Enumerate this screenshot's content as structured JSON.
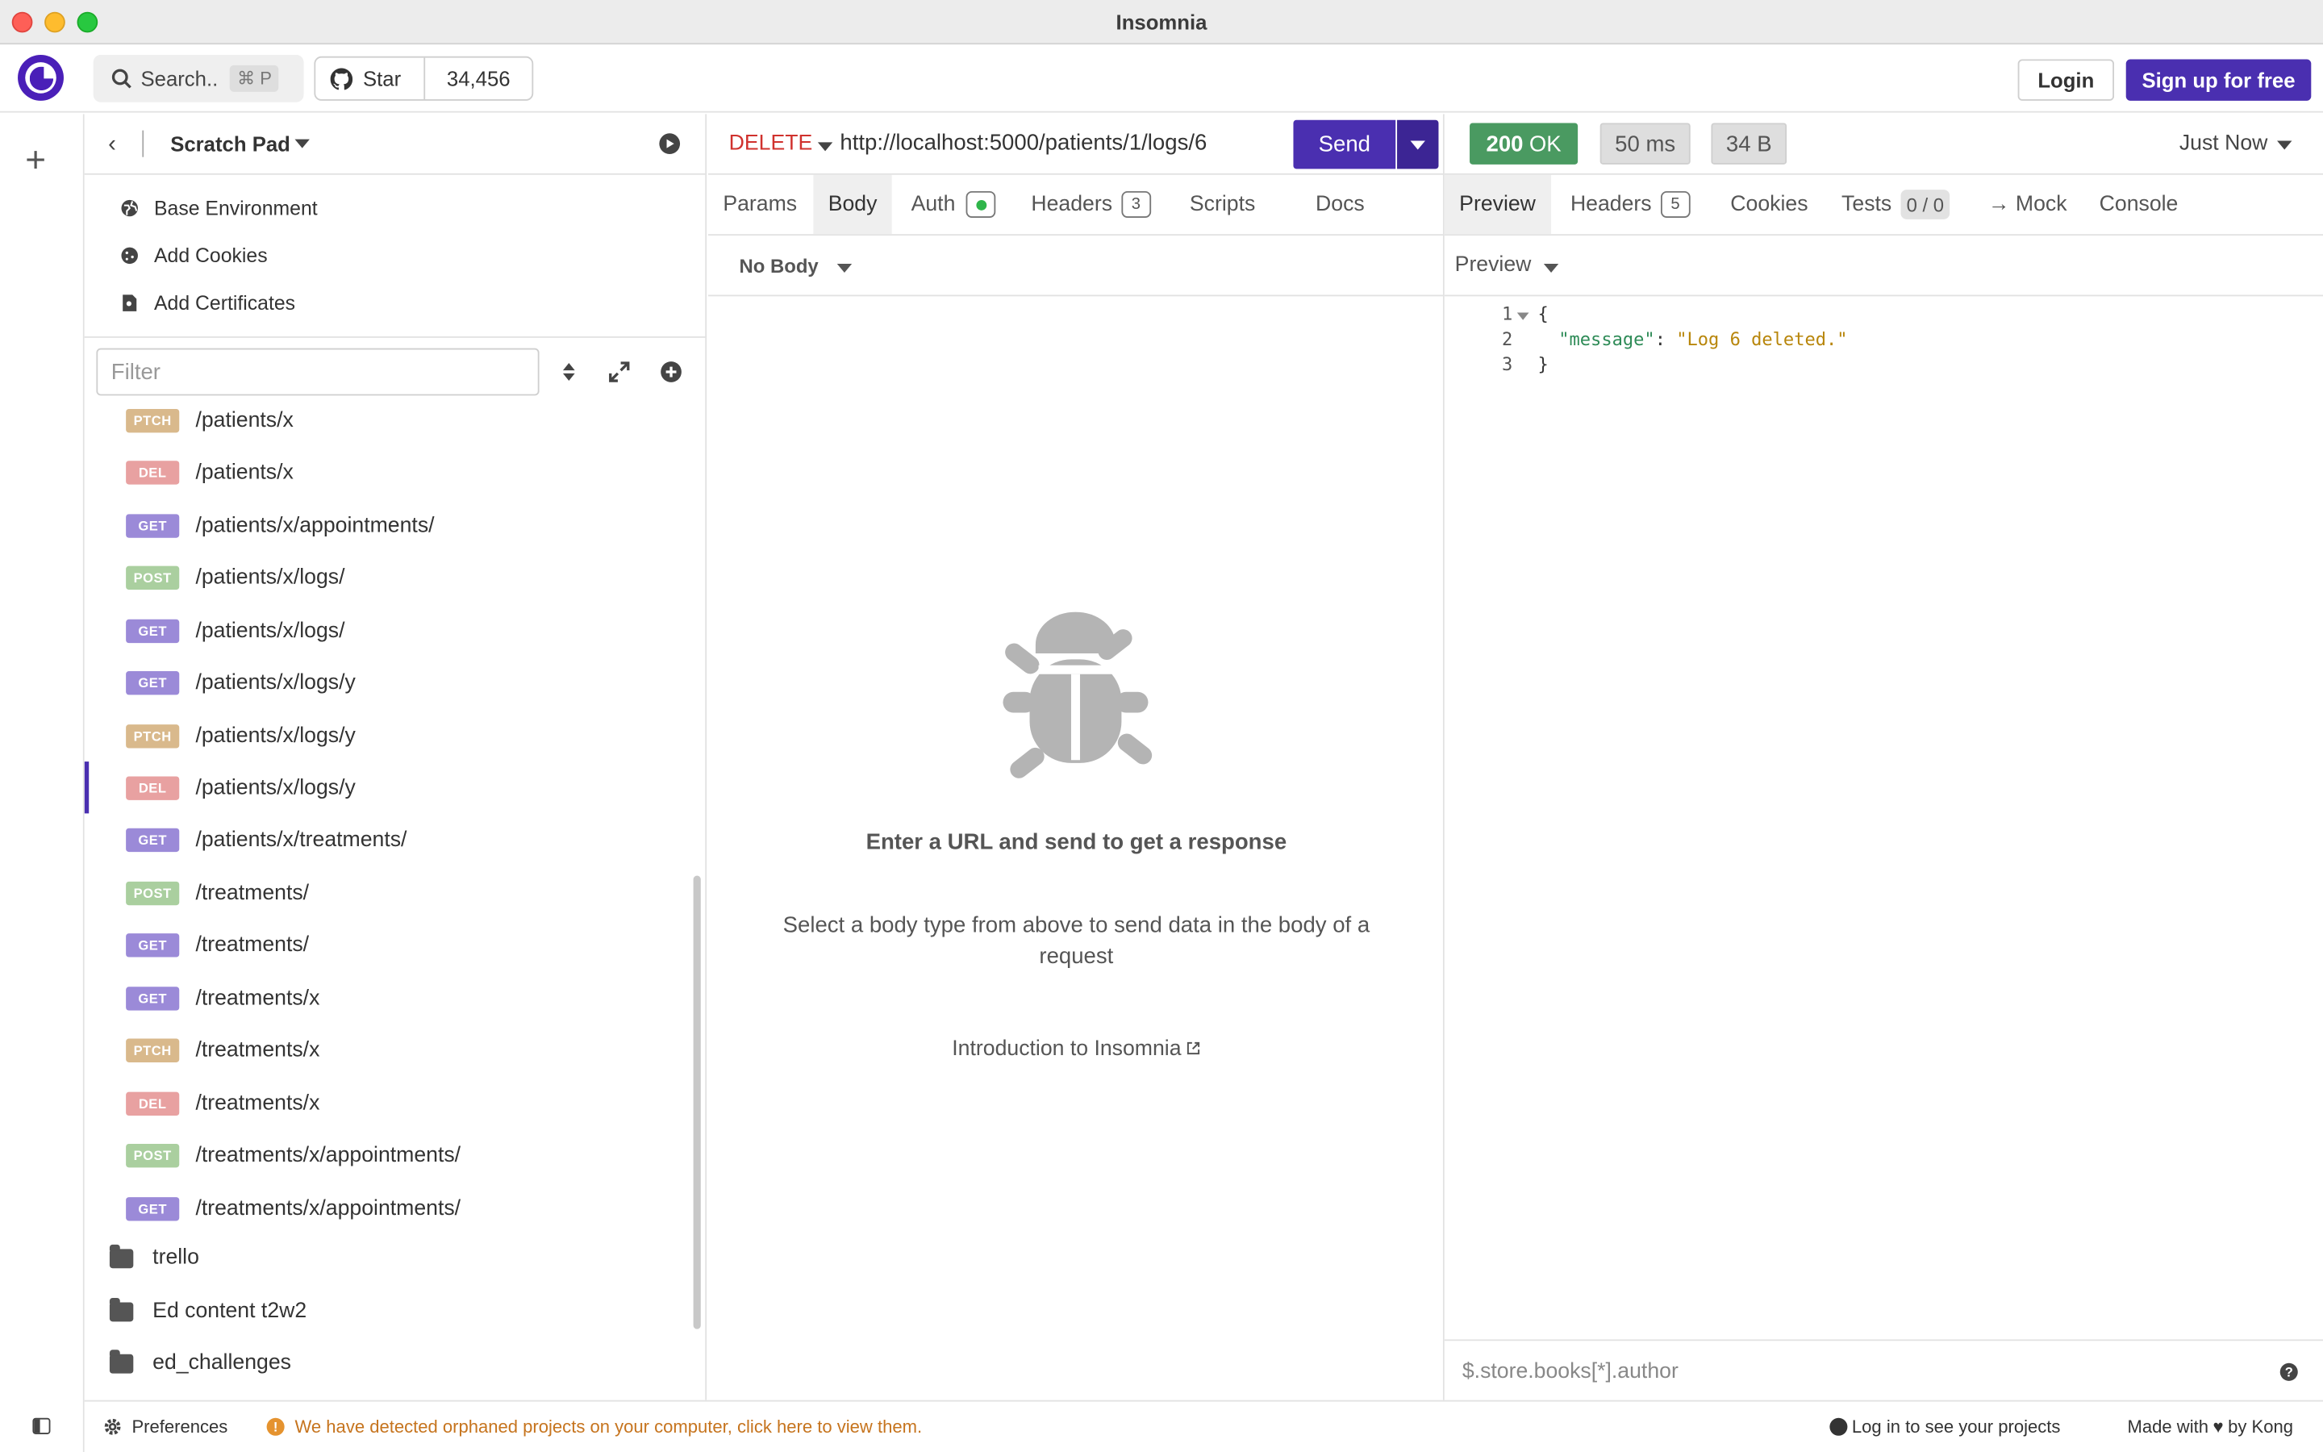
{
  "window": {
    "title": "Insomnia"
  },
  "header": {
    "search_label": "Search..",
    "search_shortcut": "⌘ P",
    "github_star_label": "Star",
    "github_star_count": "34,456",
    "login_label": "Login",
    "signup_label": "Sign up for free"
  },
  "sidebar": {
    "project_name": "Scratch Pad",
    "env_items": [
      {
        "label": "Base Environment",
        "icon": "globe-icon"
      },
      {
        "label": "Add Cookies",
        "icon": "cookie-icon"
      },
      {
        "label": "Add Certificates",
        "icon": "certificate-icon"
      }
    ],
    "filter_placeholder": "Filter",
    "requests": [
      {
        "method": "PTCH",
        "path": "/patients/x"
      },
      {
        "method": "DEL",
        "path": "/patients/x"
      },
      {
        "method": "GET",
        "path": "/patients/x/appointments/"
      },
      {
        "method": "POST",
        "path": "/patients/x/logs/"
      },
      {
        "method": "GET",
        "path": "/patients/x/logs/"
      },
      {
        "method": "GET",
        "path": "/patients/x/logs/y"
      },
      {
        "method": "PTCH",
        "path": "/patients/x/logs/y"
      },
      {
        "method": "DEL",
        "path": "/patients/x/logs/y",
        "active": true
      },
      {
        "method": "GET",
        "path": "/patients/x/treatments/"
      },
      {
        "method": "POST",
        "path": "/treatments/"
      },
      {
        "method": "GET",
        "path": "/treatments/"
      },
      {
        "method": "GET",
        "path": "/treatments/x"
      },
      {
        "method": "PTCH",
        "path": "/treatments/x"
      },
      {
        "method": "DEL",
        "path": "/treatments/x"
      },
      {
        "method": "POST",
        "path": "/treatments/x/appointments/"
      },
      {
        "method": "GET",
        "path": "/treatments/x/appointments/"
      }
    ],
    "folders": [
      {
        "label": "trello"
      },
      {
        "label": "Ed content t2w2"
      },
      {
        "label": "ed_challenges"
      }
    ]
  },
  "request": {
    "method": "DELETE",
    "url": "http://localhost:5000/patients/1/logs/6",
    "send_label": "Send",
    "tabs": {
      "params": "Params",
      "body": "Body",
      "auth": "Auth",
      "headers": "Headers",
      "headers_count": "3",
      "scripts": "Scripts",
      "docs": "Docs"
    },
    "body_type": "No Body",
    "empty_title": "Enter a URL and send to get a response",
    "empty_subtitle": "Select a body type from above to send data in the body of a request",
    "intro_link": "Introduction to Insomnia"
  },
  "response": {
    "status_code": "200",
    "status_text": "OK",
    "time": "50 ms",
    "size": "34 B",
    "timestamp": "Just Now",
    "tabs": {
      "preview": "Preview",
      "headers": "Headers",
      "headers_count": "5",
      "cookies": "Cookies",
      "tests": "Tests",
      "tests_count": "0 / 0",
      "mock": "→ Mock",
      "console": "Console"
    },
    "preview_mode": "Preview",
    "code_lines": [
      "{",
      "\"message\": \"Log 6 deleted.\"",
      "}"
    ],
    "code_key": "\"message\"",
    "code_value": "\"Log 6 deleted.\"",
    "filter_placeholder": "$.store.books[*].author"
  },
  "statusbar": {
    "preferences": "Preferences",
    "warning": "We have detected orphaned projects on your computer, click here to view them.",
    "login_projects": "Log in to see your projects",
    "made_with": "Made with",
    "by_kong": "by Kong"
  },
  "colors": {
    "accent": "#4a2fb0",
    "method_delete": "#d0312d",
    "status_ok": "#4a9a61",
    "badge_get": "#9b8ad8",
    "badge_post": "#aacf9f",
    "badge_patch": "#d9b98c",
    "badge_delete": "#e8a1a1",
    "warning": "#c6741e"
  }
}
